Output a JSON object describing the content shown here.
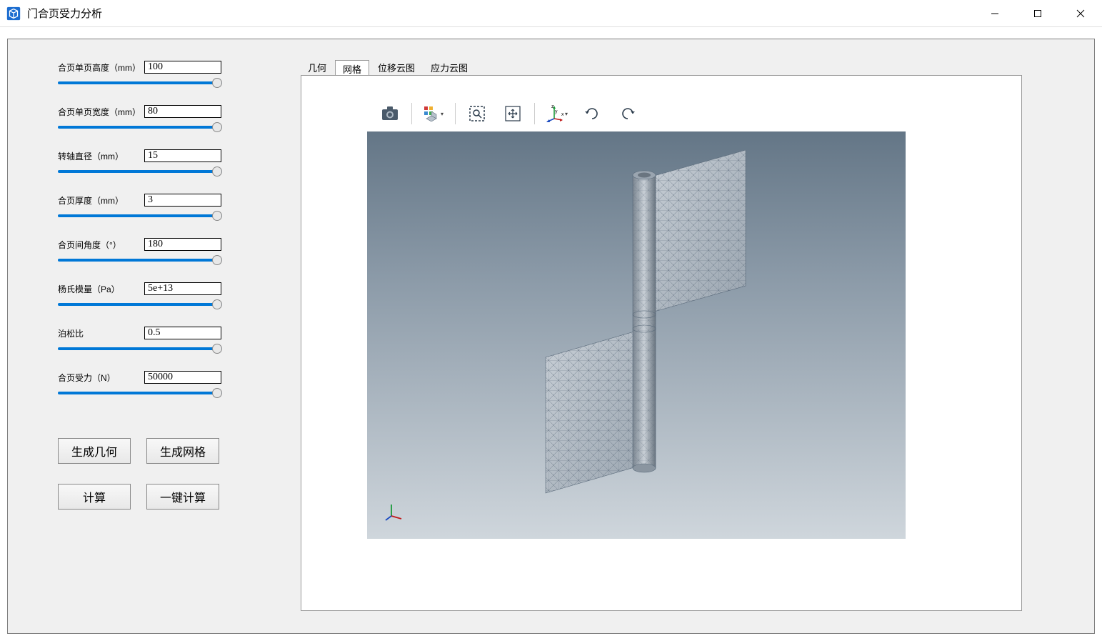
{
  "window": {
    "title": "门合页受力分析"
  },
  "params": [
    {
      "label": "合页单页高度（mm）",
      "value": "100"
    },
    {
      "label": "合页单页宽度（mm）",
      "value": "80"
    },
    {
      "label": "转轴直径（mm）",
      "value": "15"
    },
    {
      "label": "合页厚度（mm）",
      "value": "3"
    },
    {
      "label": "合页间角度（°）",
      "value": "180"
    },
    {
      "label": "杨氏模量（Pa）",
      "value": "5e+13"
    },
    {
      "label": "泊松比",
      "value": "0.5"
    },
    {
      "label": "合页受力（N）",
      "value": "50000"
    }
  ],
  "buttons": {
    "gen_geom": "生成几何",
    "gen_mesh": "生成网格",
    "compute": "计算",
    "one_click": "一键计算"
  },
  "tabs": [
    {
      "label": "几何",
      "active": false
    },
    {
      "label": "网格",
      "active": true
    },
    {
      "label": "位移云图",
      "active": false
    },
    {
      "label": "应力云图",
      "active": false
    }
  ]
}
